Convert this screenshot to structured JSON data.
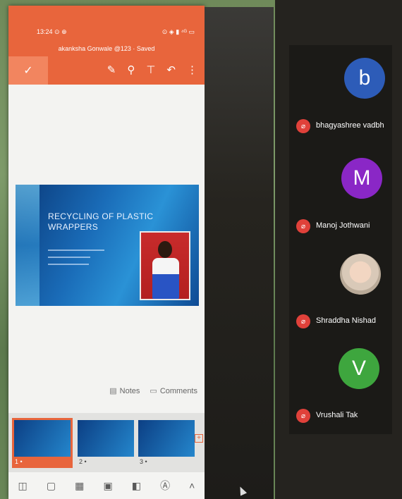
{
  "phone": {
    "status_time": "13:24",
    "status_icons": "⊙ ⊕",
    "status_right": "⊙ ◈ ▮ ⁴ᴳ ▭",
    "doc_title": "akanksha Gonwale @123 · Saved",
    "toolbar_icons": [
      "draw-icon",
      "search-icon",
      "present-icon",
      "undo-icon",
      "more-icon"
    ],
    "slide": {
      "title_line1": "RECYCLING OF PLASTIC",
      "title_line2": "WRAPPERS"
    },
    "notes_label": "Notes",
    "comments_label": "Comments",
    "thumbnails": [
      {
        "number": "1"
      },
      {
        "number": "2"
      },
      {
        "number": "3"
      }
    ],
    "accent": "#e8653c"
  },
  "participants": [
    {
      "name": "bhagyashree vadbh",
      "initial": "b",
      "color": "#2d5cb8",
      "muted": true
    },
    {
      "name": "Manoj Jothwani",
      "initial": "M",
      "color": "#8a27c6",
      "muted": true
    },
    {
      "name": "Shraddha Nishad",
      "initial": "",
      "color": "#d8c8b4",
      "muted": true,
      "photo": true
    },
    {
      "name": "Vrushali Tak",
      "initial": "V",
      "color": "#3ea63e",
      "muted": true
    }
  ]
}
